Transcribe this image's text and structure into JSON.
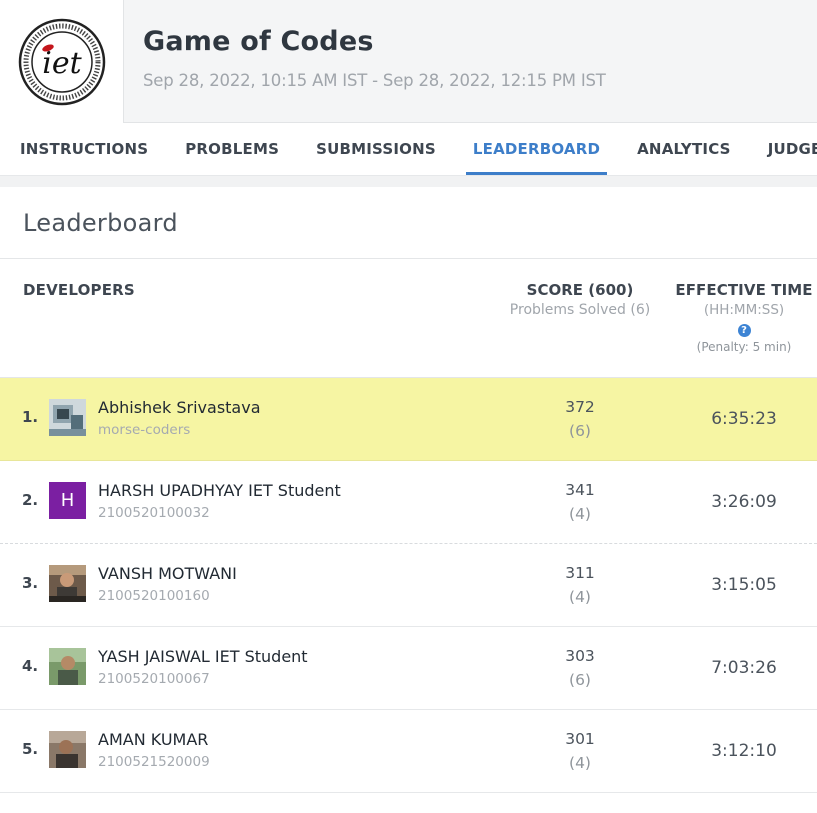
{
  "header": {
    "logo_text": "iet",
    "title": "Game of Codes",
    "dates": "Sep 28, 2022, 10:15 AM IST - Sep 28, 2022, 12:15 PM IST"
  },
  "tabs": [
    {
      "label": "INSTRUCTIONS"
    },
    {
      "label": "PROBLEMS"
    },
    {
      "label": "SUBMISSIONS"
    },
    {
      "label": "LEADERBOARD"
    },
    {
      "label": "ANALYTICS"
    },
    {
      "label": "JUDGE"
    }
  ],
  "leaderboard": {
    "title": "Leaderboard",
    "columns": {
      "developers": "DEVELOPERS",
      "score": "SCORE",
      "score_total": "(600)",
      "problems_solved": "Problems Solved (6)",
      "effective_time": "EFFECTIVE TIME",
      "time_format": "(HH:MM:SS)",
      "help_glyph": "?",
      "penalty": "(Penalty: 5 min)"
    },
    "rows": [
      {
        "rank": "1.",
        "name": "Abhishek Srivastava",
        "sub": "morse-coders",
        "score": "372",
        "solved": "(6)",
        "time": "6:35:23",
        "avatar_letter": ""
      },
      {
        "rank": "2.",
        "name": "HARSH UPADHYAY IET Student",
        "sub": "2100520100032",
        "score": "341",
        "solved": "(4)",
        "time": "3:26:09",
        "avatar_letter": "H"
      },
      {
        "rank": "3.",
        "name": "VANSH MOTWANI",
        "sub": "2100520100160",
        "score": "311",
        "solved": "(4)",
        "time": "3:15:05",
        "avatar_letter": ""
      },
      {
        "rank": "4.",
        "name": "YASH JAISWAL IET Student",
        "sub": "2100520100067",
        "score": "303",
        "solved": "(6)",
        "time": "7:03:26",
        "avatar_letter": ""
      },
      {
        "rank": "5.",
        "name": "AMAN KUMAR",
        "sub": "2100521520009",
        "score": "301",
        "solved": "(4)",
        "time": "3:12:10",
        "avatar_letter": ""
      }
    ]
  },
  "colors": {
    "accent": "#3d7ec9",
    "highlight": "#f6f5a3",
    "avatar_purple": "#7b1fa2"
  }
}
